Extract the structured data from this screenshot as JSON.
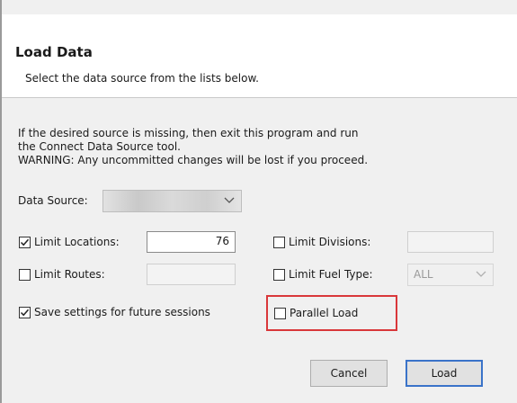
{
  "dialog": {
    "title": "Load Data",
    "subtitle": "Select the data source from the lists below."
  },
  "messages": {
    "line1": "If the desired source is missing, then exit this program and run",
    "line2": "the Connect Data Source tool.",
    "line3": "WARNING: Any uncommitted changes will be lost if you proceed."
  },
  "data_source": {
    "label": "Data Source:",
    "value": ""
  },
  "options": {
    "limit_locations": {
      "label": "Limit Locations:",
      "checked": true,
      "value": "76"
    },
    "limit_divisions": {
      "label": "Limit Divisions:",
      "checked": false,
      "value": ""
    },
    "limit_routes": {
      "label": "Limit Routes:",
      "checked": false,
      "value": ""
    },
    "limit_fuel_type": {
      "label": "Limit Fuel Type:",
      "checked": false,
      "value": "ALL"
    },
    "save_settings": {
      "label": "Save settings for future sessions",
      "checked": true
    },
    "parallel_load": {
      "label": "Parallel Load",
      "checked": false
    }
  },
  "buttons": {
    "cancel": "Cancel",
    "load": "Load"
  },
  "colors": {
    "highlight": "#d9373a",
    "default_button_border": "#3a73c9",
    "body_background": "#f0f0f0"
  }
}
